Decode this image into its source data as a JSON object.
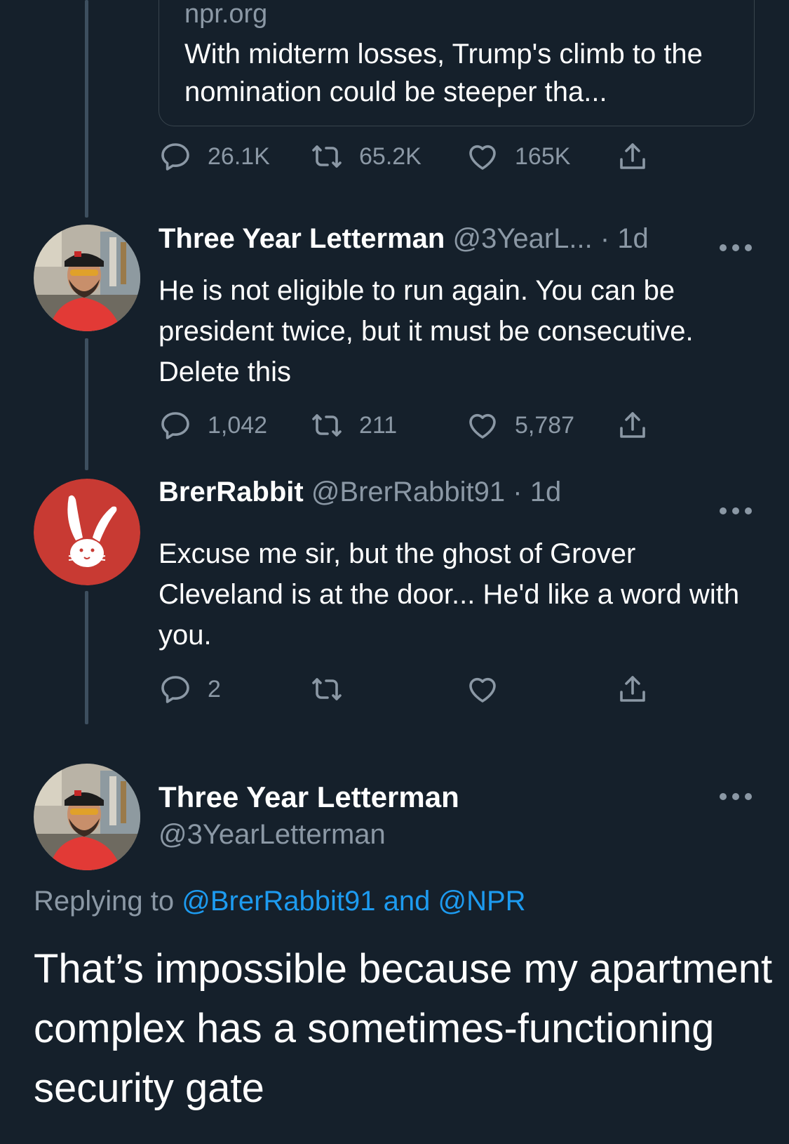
{
  "quoted_card": {
    "domain": "npr.org",
    "title": "With midterm losses, Trump's climb to the nomination could be steeper tha..."
  },
  "tweets": [
    {
      "actions": {
        "replies": "26.1K",
        "retweets": "65.2K",
        "likes": "165K"
      }
    },
    {
      "display_name": "Three Year Letterman",
      "handle": "@3YearL...",
      "separator": "·",
      "time": "1d",
      "text": "He is not eligible to run again. You can be president twice, but it must be consecutive. Delete this",
      "actions": {
        "replies": "1,042",
        "retweets": "211",
        "likes": "5,787"
      }
    },
    {
      "display_name": "BrerRabbit",
      "handle": "@BrerRabbit91",
      "separator": "·",
      "time": "1d",
      "text": "Excuse me sir, but the ghost of Grover Cleveland is at the door... He'd like a word with you.",
      "actions": {
        "replies": "2",
        "retweets": "",
        "likes": ""
      }
    }
  ],
  "main_tweet": {
    "display_name": "Three Year Letterman",
    "handle": "@3YearLetterman",
    "replying_prefix": "Replying to",
    "replying_to": "@BrerRabbit91 and @NPR",
    "text": "That’s impossible because my apartment complex has a sometimes-functioning security gate"
  },
  "icons": {
    "reply": "reply-icon",
    "retweet": "retweet-icon",
    "like": "heart-icon",
    "share": "share-icon",
    "more": "more-icon"
  },
  "colors": {
    "background": "#15202b",
    "secondary_text": "#8b98a5",
    "link": "#1d9bf0",
    "thread_line": "#3d4f5f",
    "brerrabbit_avatar": "#c83a33"
  }
}
